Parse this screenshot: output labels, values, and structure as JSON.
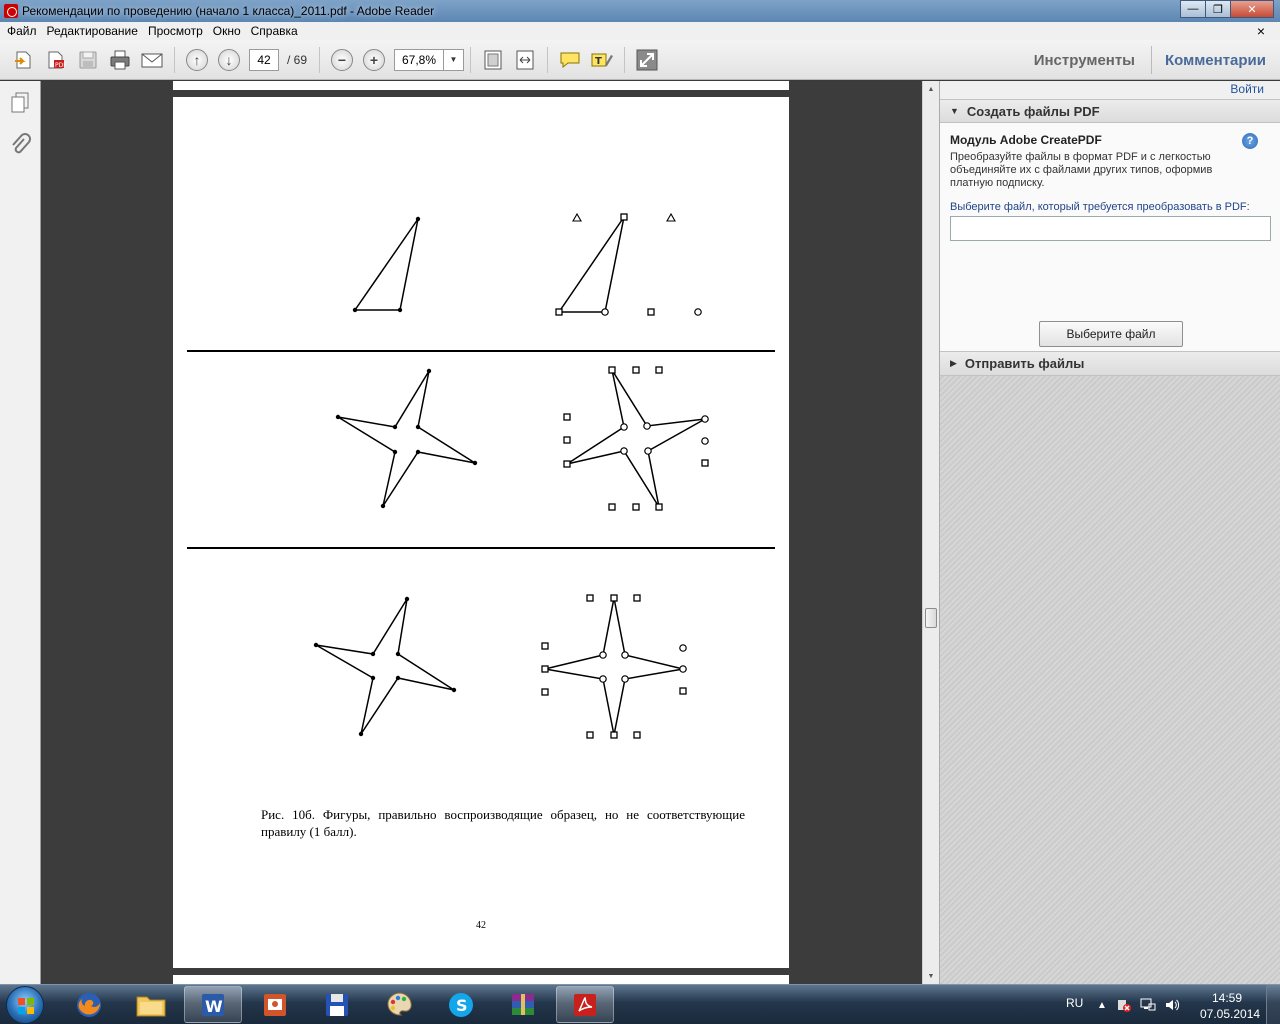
{
  "window": {
    "title": "Рекомендации по проведению (начало 1 класса)_2011.pdf - Adobe Reader",
    "minimize": "—",
    "maximize": "❐",
    "close": "✕"
  },
  "menu": {
    "items": [
      "Файл",
      "Редактирование",
      "Просмотр",
      "Окно",
      "Справка"
    ],
    "close": "×"
  },
  "toolbar": {
    "page_current": "42",
    "page_total": "/ 69",
    "zoom": "67,8%",
    "tools_label": "Инструменты",
    "comments_label": "Комментарии"
  },
  "document": {
    "caption": "Рис. 10б. Фигуры, правильно воспроизводящие образец, но не соответствующие правилу (1 балл).",
    "page_number": "42"
  },
  "right_panel": {
    "login": "Войти",
    "create_section": {
      "title": "Создать файлы PDF",
      "module_title": "Модуль Adobe CreatePDF",
      "description": "Преобразуйте файлы в формат PDF и с легкостью объединяйте их с файлами других типов, оформив платную подписку.",
      "choose_label": "Выберите файл, который требуется преобразовать в PDF:",
      "file_value": "",
      "choose_button": "Выберите файл"
    },
    "send_section": {
      "title": "Отправить файлы"
    },
    "help_glyph": "?"
  },
  "taskbar": {
    "lang": "RU",
    "time": "14:59",
    "date": "07.05.2014"
  },
  "colors": {
    "accent": "#4a6a99",
    "link": "#24549a",
    "titlebar": "#6c93bd",
    "taskbar": "#24364b"
  }
}
